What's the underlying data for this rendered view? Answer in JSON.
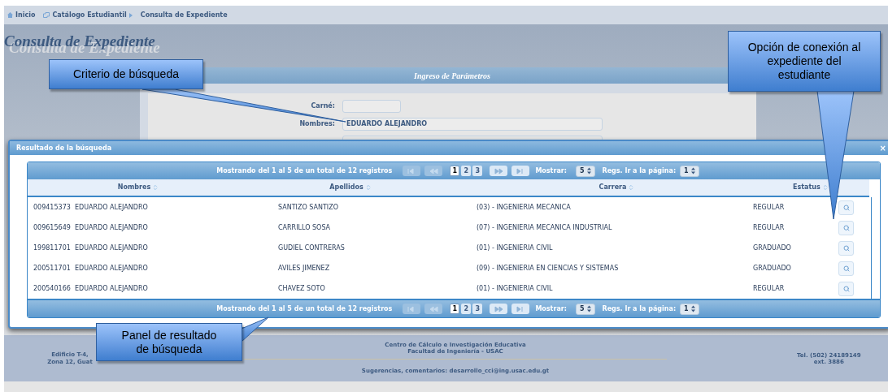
{
  "breadcrumb": [
    {
      "label": "Inicio"
    },
    {
      "label": "Catálogo Estudiantil"
    },
    {
      "label": "Consulta de Expediente"
    }
  ],
  "page_title": "Consulta de Expediente",
  "form": {
    "title": "Ingreso de Parámetros",
    "fields": [
      {
        "label": "Carné:"
      },
      {
        "label": "Nombres:",
        "value": "EDUARDO ALEJANDRO"
      }
    ]
  },
  "dialog": {
    "title": "Resultado de la búsqueda",
    "close": "×",
    "pager_top": {
      "info": "Mostrando del 1 al 5 de un total de 12 registros",
      "nav": [
        {
          "kind": "first",
          "disabled": true
        },
        {
          "kind": "prev",
          "disabled": true
        },
        {
          "kind": "next",
          "disabled": false
        },
        {
          "kind": "last",
          "disabled": false
        }
      ],
      "pages": [
        {
          "label": "1",
          "selected": true
        },
        {
          "label": "2",
          "selected": false
        },
        {
          "label": "3",
          "selected": false
        }
      ],
      "show_label": "Mostrar:",
      "show_value": "5",
      "goto_label": "Regs. Ir a la página:",
      "goto_value": "1"
    },
    "columns": [
      "Nombres",
      "Apellidos",
      "Carrera",
      "Estatus"
    ],
    "rows": [
      {
        "carne": "009415373",
        "nombres": "EDUARDO ALEJANDRO",
        "apellidos": "SANTIZO SANTIZO",
        "carrera": "(03) - INGENIERIA MECANICA",
        "estatus": "REGULAR"
      },
      {
        "carne": "009615649",
        "nombres": "EDUARDO ALEJANDRO",
        "apellidos": "CARRILLO SOSA",
        "carrera": "(07) - INGENIERIA MECANICA INDUSTRIAL",
        "estatus": "REGULAR"
      },
      {
        "carne": "199811701",
        "nombres": "EDUARDO ALEJANDRO",
        "apellidos": "GUDIEL CONTRERAS",
        "carrera": "(01) - INGENIERIA CIVIL",
        "estatus": "GRADUADO"
      },
      {
        "carne": "200511701",
        "nombres": "EDUARDO ALEJANDRO",
        "apellidos": "AVILES JIMENEZ",
        "carrera": "(09) - INGENIERIA EN CIENCIAS Y SISTEMAS",
        "estatus": "GRADUADO"
      },
      {
        "carne": "200540166",
        "nombres": "EDUARDO ALEJANDRO",
        "apellidos": "CHAVEZ SOTO",
        "carrera": "(01) - INGENIERIA CIVIL",
        "estatus": "REGULAR"
      }
    ],
    "pager_bottom": {
      "info": "Mostrando del 1 al 5 de un total de 12 registros",
      "nav": [
        {
          "kind": "first",
          "disabled": true
        },
        {
          "kind": "prev",
          "disabled": true
        },
        {
          "kind": "next",
          "disabled": false
        },
        {
          "kind": "last",
          "disabled": false
        }
      ],
      "pages": [
        {
          "label": "1",
          "selected": true
        },
        {
          "label": "2",
          "selected": false
        },
        {
          "label": "3",
          "selected": false
        }
      ],
      "show_label": "Mostrar:",
      "show_value": "5",
      "goto_label": "Regs. Ir a la página:",
      "goto_value": "1"
    }
  },
  "footer": {
    "address": [
      "Edificio T-4,",
      "Zona 12, Guat"
    ],
    "center": [
      "Centro de Cálculo e Investigación Educativa",
      "Facultad de Ingeniería - USAC"
    ],
    "contact": "Sugerencias, comentarios: desarrollo_cci@ing.usac.edu.gt",
    "phone": [
      "Tel. (502) 24189149",
      "ext. 3886"
    ]
  },
  "callouts": [
    {
      "text": "Criterio de búsqueda"
    },
    {
      "text": "Opción de conexión al expediente del estudiante"
    },
    {
      "text": "Panel de resultado de búsqueda"
    }
  ]
}
